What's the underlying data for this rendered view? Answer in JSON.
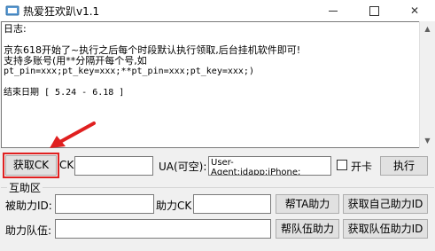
{
  "window": {
    "title": "热爱狂欢趴v1.1",
    "minimize_glyph": "",
    "close_glyph": "✕"
  },
  "log": {
    "lines": [
      "日志:",
      "",
      "京东618开始了~执行之后每个时段默认执行领取,后台挂机软件即可!",
      "支持多账号(用**分隔开每个号,如",
      "pt_pin=xxx;pt_key=xxx;**pt_pin=xxx;pt_key=xxx;)",
      "",
      "结束日期 [ 5.24 - 6.18 ]"
    ]
  },
  "controls": {
    "get_ck_button": "获取CK",
    "ck_label": "CK",
    "ck_value": "",
    "ua_label": "UA(可空):",
    "ua_value": "User-\nAgent:jdapp;iPhone;",
    "open_card_label": "开卡",
    "open_card_checked": false,
    "execute_button": "执行"
  },
  "help_section": {
    "title": "互助区",
    "helped_id_label": "被助力ID:",
    "helped_id_value": "",
    "help_ck_label": "助力CK",
    "help_ck_value": "",
    "help_ta_button": "帮TA助力",
    "get_own_id_button": "获取自己助力ID",
    "team_label": "助力队伍:",
    "team_value": "",
    "help_team_button": "帮队伍助力",
    "get_team_id_button": "获取队伍助力ID"
  },
  "colors": {
    "highlight": "#e02020",
    "window_bg": "#f0f0f0"
  }
}
